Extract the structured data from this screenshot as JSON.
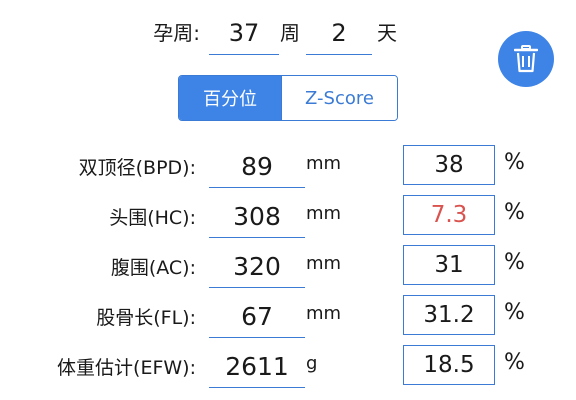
{
  "gestational_age": {
    "label": "孕周:",
    "weeks": "37",
    "weeks_unit": "周",
    "days": "2",
    "days_unit": "天"
  },
  "delete_button": {
    "icon": "trash-icon",
    "color": "#3e84e6"
  },
  "mode_toggle": {
    "options": [
      "百分位",
      "Z-Score"
    ],
    "selected": "百分位",
    "accent_color": "#3e84e6"
  },
  "measurements": [
    {
      "label": "双顶径(BPD):",
      "value": "89",
      "unit": "mm",
      "percentile": "38",
      "percent_sign": "%"
    },
    {
      "label": "头围(HC):",
      "value": "308",
      "unit": "mm",
      "percentile": "7.3",
      "percent_sign": "%",
      "highlight_color": "#d9534f"
    },
    {
      "label": "腹围(AC):",
      "value": "320",
      "unit": "mm",
      "percentile": "31",
      "percent_sign": "%"
    },
    {
      "label": "股骨长(FL):",
      "value": "67",
      "unit": "mm",
      "percentile": "31.2",
      "percent_sign": "%"
    },
    {
      "label": "体重估计(EFW):",
      "value": "2611",
      "unit": "g",
      "percentile": "18.5",
      "percent_sign": "%"
    }
  ]
}
